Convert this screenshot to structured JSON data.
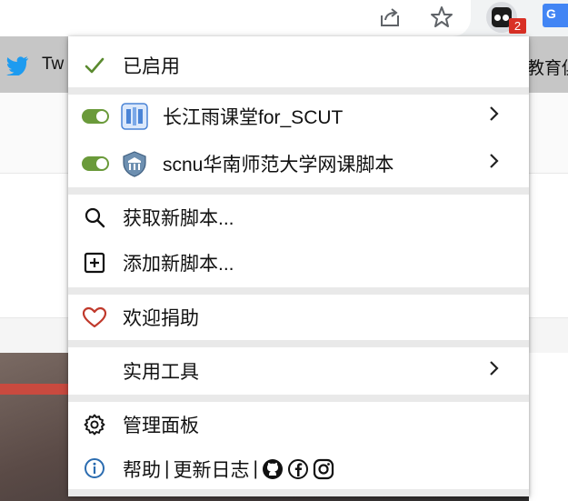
{
  "bookmarks": {
    "left_label": "Tw",
    "right_label": "教育俱"
  },
  "extension": {
    "badge_count": "2"
  },
  "menu": {
    "enabled_label": "已启用",
    "scripts": [
      {
        "name": "长江雨课堂for_SCUT",
        "enabled": true
      },
      {
        "name": "scnu华南师范大学网课脚本",
        "enabled": true
      }
    ],
    "get_scripts": "获取新脚本...",
    "add_script": "添加新脚本...",
    "donate": "欢迎捐助",
    "utilities": "实用工具",
    "dashboard": "管理面板",
    "help": "帮助",
    "divider1": "|",
    "changelog": "更新日志",
    "divider2": "|"
  },
  "colors": {
    "toggle_on": "#6a9a3a",
    "donate_heart": "#c0392b",
    "info_icon": "#2b6cb0",
    "badge": "#d93025"
  }
}
